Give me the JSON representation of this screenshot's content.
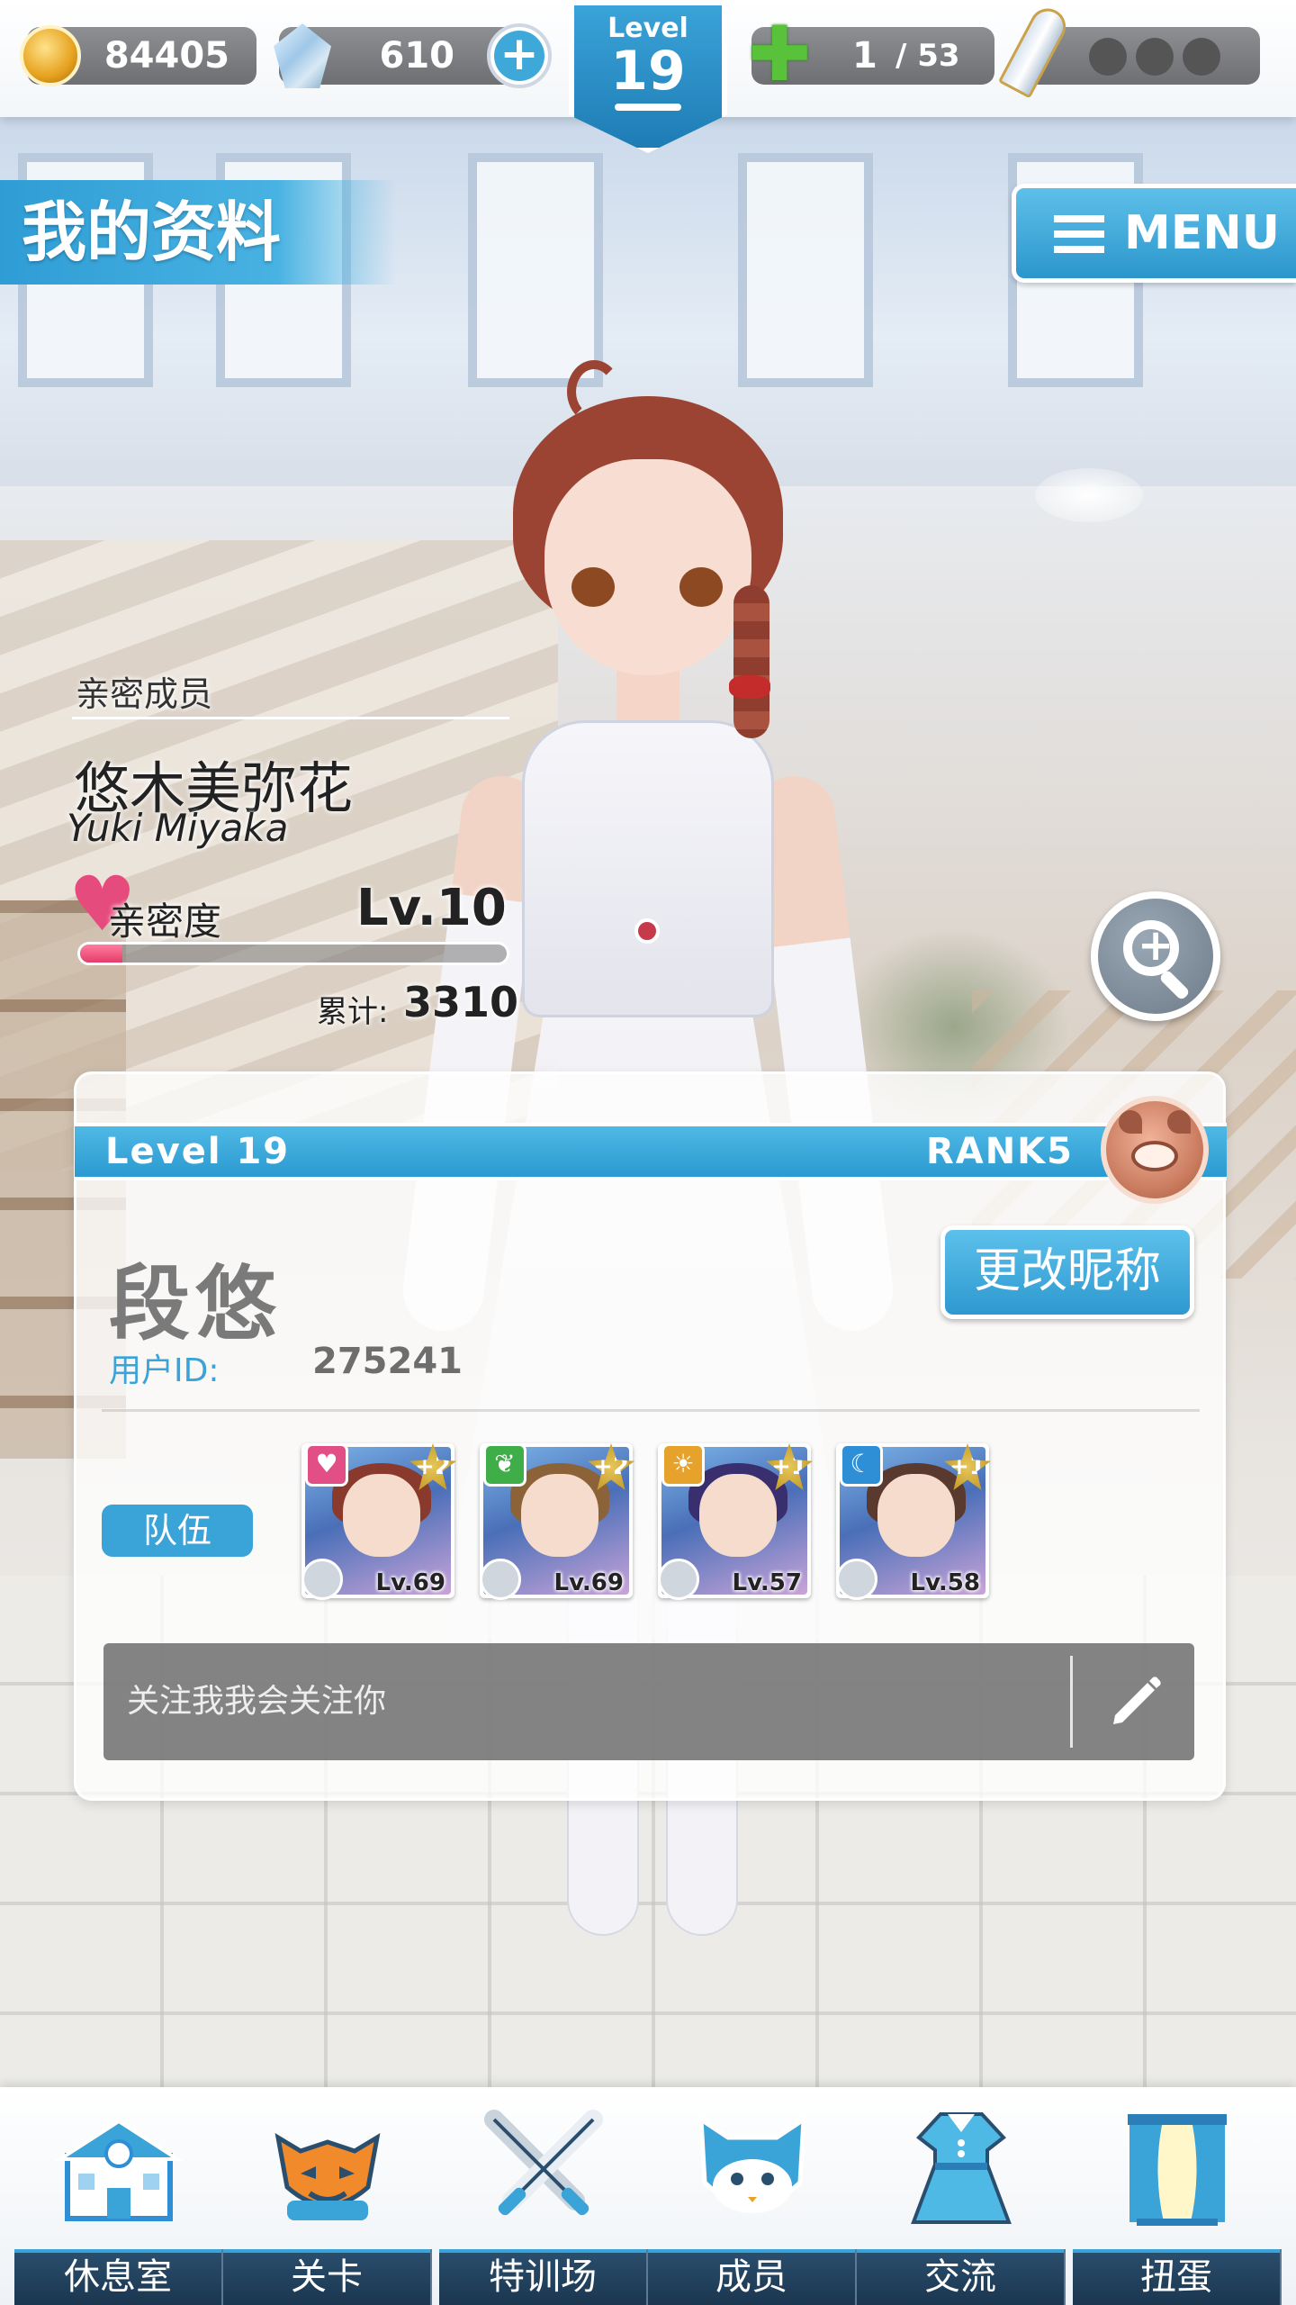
{
  "colors": {
    "accent": "#3aa3d8",
    "affinity": "#e54c7d",
    "nav_bg": "#1b3650"
  },
  "header": {
    "coins": "84405",
    "gems": "610",
    "level_label": "Level",
    "level_value": "19",
    "stamina_current": "1",
    "stamina_max": "/ 53"
  },
  "page": {
    "title": "我的资料",
    "menu_label": "MENU"
  },
  "affinity": {
    "subtitle": "亲密成员",
    "name": "悠木美弥花",
    "name_roman": "Yuki Miyaka",
    "label": "亲密度",
    "level": "Lv.10",
    "progress": 0.1,
    "total_label": "累计:",
    "total_value": "3310"
  },
  "profile": {
    "level_text": "Level 19",
    "rank_text": "RANK5",
    "nickname": "段悠",
    "uid_label": "用户ID:",
    "uid_value": "275241",
    "rename_button": "更改昵称",
    "team_label": "队伍",
    "team": [
      {
        "level": "Lv.69",
        "plus": "+2",
        "attr_icon": "heart-attr-icon",
        "attr_color": "#e14f86",
        "hair": "#8a3a2c"
      },
      {
        "level": "Lv.69",
        "plus": "+2",
        "attr_icon": "leaf-attr-icon",
        "attr_color": "#3fae49",
        "hair": "#8c6238"
      },
      {
        "level": "Lv.57",
        "plus": "+1",
        "attr_icon": "sun-attr-icon",
        "attr_color": "#e6a22a",
        "hair": "#3a2f6e"
      },
      {
        "level": "Lv.58",
        "plus": "+1",
        "attr_icon": "moon-attr-icon",
        "attr_color": "#2f8fd6",
        "hair": "#5a3a2e"
      }
    ],
    "message": "关注我我会关注你"
  },
  "nav": [
    {
      "label": "休息室",
      "icon": "school-icon"
    },
    {
      "label": "关卡",
      "icon": "monster-icon"
    },
    {
      "label": "特训场",
      "icon": "crossed-swords-icon"
    },
    {
      "label": "成员",
      "icon": "cat-mascot-icon"
    },
    {
      "label": "交流",
      "icon": "dress-icon"
    },
    {
      "label": "扭蛋",
      "icon": "curtain-window-icon"
    }
  ]
}
